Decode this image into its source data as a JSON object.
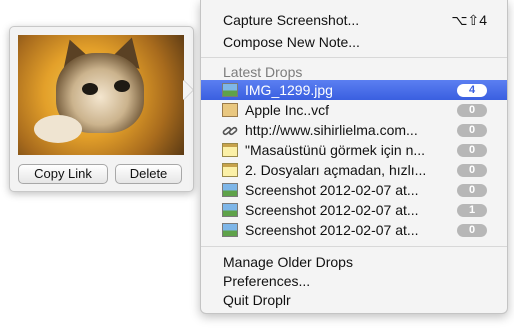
{
  "preview": {
    "copy_link_label": "Copy Link",
    "delete_label": "Delete"
  },
  "menu": {
    "capture_label": "Capture Screenshot...",
    "capture_shortcut": "⌥⇧4",
    "compose_label": "Compose New Note...",
    "latest_title": "Latest Drops",
    "drops": [
      {
        "label": "IMG_1299.jpg",
        "count": "4",
        "icon": "image-icon"
      },
      {
        "label": "Apple Inc..vcf",
        "count": "0",
        "icon": "contact-card-icon"
      },
      {
        "label": "http://www.sihirlielma.com...",
        "count": "0",
        "icon": "link-icon"
      },
      {
        "label": "\"Masaüstünü görmek için n...",
        "count": "0",
        "icon": "note-icon"
      },
      {
        "label": "2. Dosyaları açmadan, hızlı...",
        "count": "0",
        "icon": "note-icon"
      },
      {
        "label": "Screenshot 2012-02-07 at...",
        "count": "0",
        "icon": "image-icon"
      },
      {
        "label": "Screenshot 2012-02-07 at...",
        "count": "1",
        "icon": "image-icon"
      },
      {
        "label": "Screenshot 2012-02-07 at...",
        "count": "0",
        "icon": "image-icon"
      }
    ],
    "manage_label": "Manage Older Drops",
    "prefs_label": "Preferences...",
    "quit_label": "Quit Droplr"
  },
  "colors": {
    "selection": "#3a5fe0",
    "badge": "#b7b7b7"
  }
}
